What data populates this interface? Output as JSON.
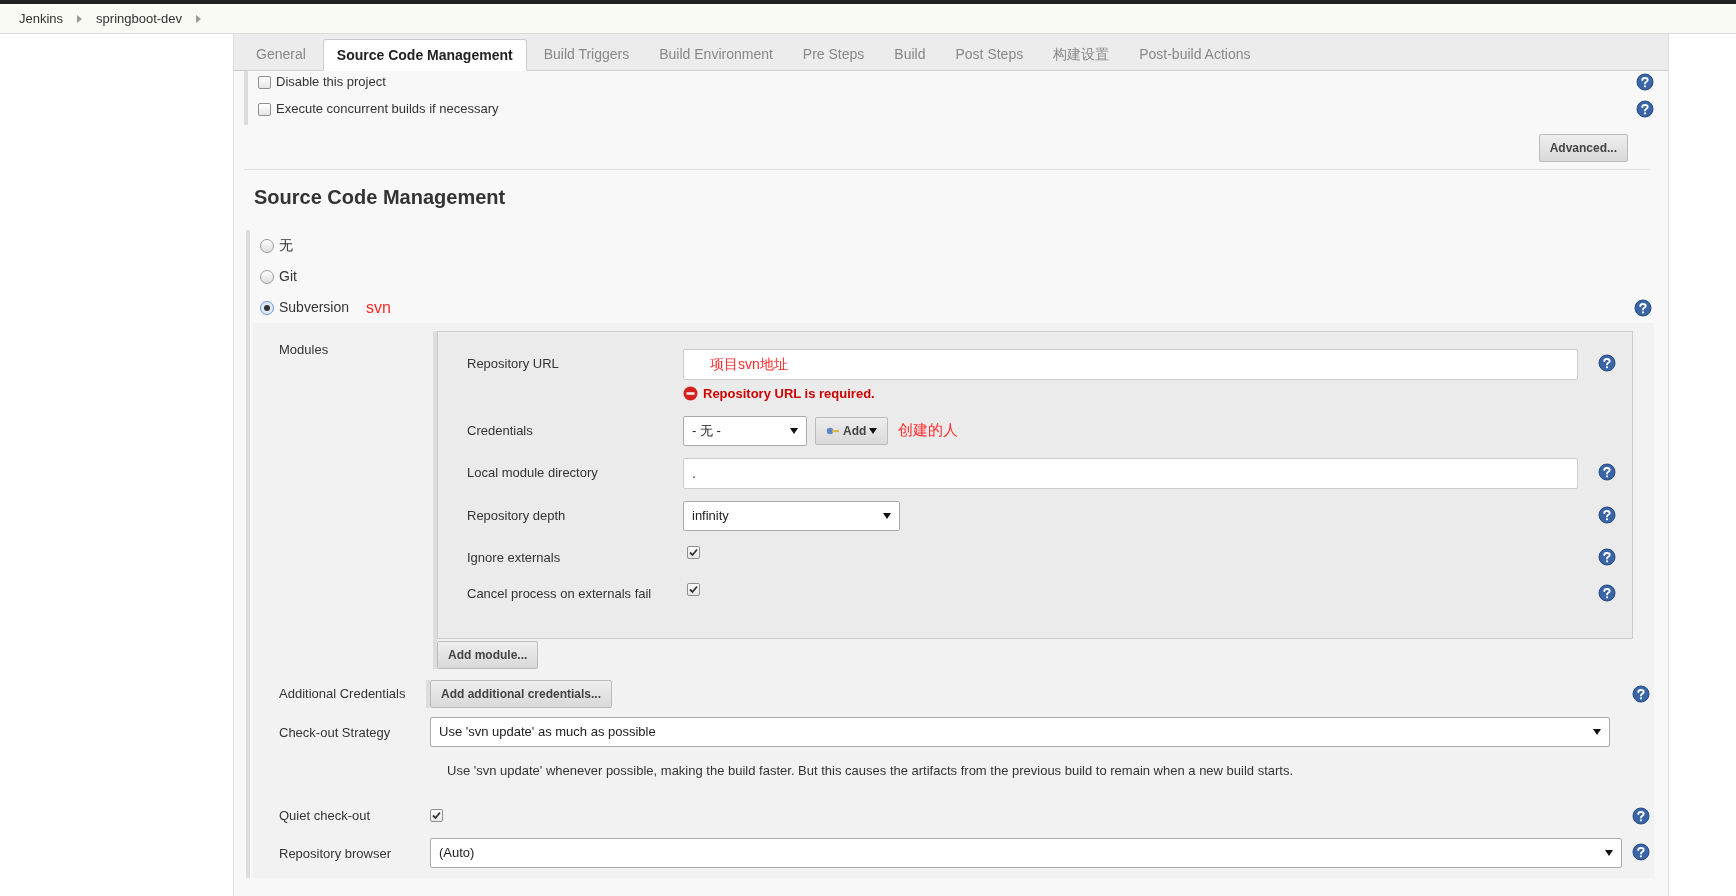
{
  "breadcrumbs": [
    {
      "label": "Jenkins"
    },
    {
      "label": "springboot-dev"
    }
  ],
  "tabs": [
    {
      "label": "General",
      "selected": false
    },
    {
      "label": "Source Code Management",
      "selected": true
    },
    {
      "label": "Build Triggers",
      "selected": false
    },
    {
      "label": "Build Environment",
      "selected": false
    },
    {
      "label": "Pre Steps",
      "selected": false
    },
    {
      "label": "Build",
      "selected": false
    },
    {
      "label": "Post Steps",
      "selected": false
    },
    {
      "label": "构建设置",
      "selected": false
    },
    {
      "label": "Post-build Actions",
      "selected": false
    }
  ],
  "general_options": [
    {
      "label": "Disable this project",
      "checked": false
    },
    {
      "label": "Execute concurrent builds if necessary",
      "checked": false
    }
  ],
  "advanced_button": "Advanced...",
  "section_title": "Source Code Management",
  "scm_options": [
    {
      "label": "无",
      "selected": false,
      "help": false
    },
    {
      "label": "Git",
      "selected": false,
      "help": false
    },
    {
      "label": "Subversion",
      "selected": true,
      "help": true,
      "annotation": "svn"
    }
  ],
  "modules": {
    "label": "Modules",
    "fields": [
      {
        "kind": "text",
        "label": "Repository URL",
        "value": "项目svn地址",
        "annotated": true,
        "help": true,
        "error": "Repository URL is required."
      },
      {
        "kind": "credentials",
        "label": "Credentials",
        "value": "- 无 -",
        "button": "Add",
        "annotation": "创建的人",
        "help": false
      },
      {
        "kind": "text",
        "label": "Local module directory",
        "value": ".",
        "annotated": false,
        "help": true
      },
      {
        "kind": "select",
        "label": "Repository depth",
        "value": "infinity",
        "help": true
      },
      {
        "kind": "checkbox",
        "label": "Ignore externals",
        "checked": true,
        "help": true
      },
      {
        "kind": "checkbox",
        "label": "Cancel process on externals fail",
        "checked": true,
        "help": true
      }
    ],
    "add_button": "Add module..."
  },
  "additional_credentials": {
    "label": "Additional Credentials",
    "button": "Add additional credentials..."
  },
  "checkout_strategy": {
    "label": "Check-out Strategy",
    "value": "Use 'svn update' as much as possible",
    "description": "Use 'svn update' whenever possible, making the build faster. But this causes the artifacts from the previous build to remain when a new build starts."
  },
  "quiet_checkout": {
    "label": "Quiet check-out",
    "checked": true
  },
  "repository_browser": {
    "label": "Repository browser",
    "value": "(Auto)"
  }
}
